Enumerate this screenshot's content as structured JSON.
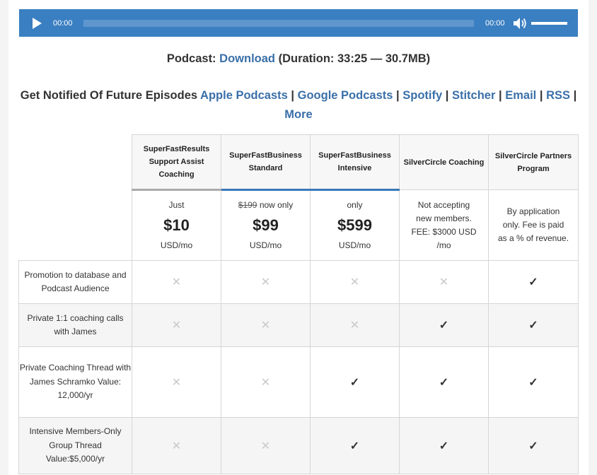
{
  "player": {
    "current_time": "00:00",
    "duration_time": "00:00",
    "colors": {
      "bar": "#3a7fc1",
      "rail": "#5f96cd"
    }
  },
  "podcast": {
    "prefix": "Podcast:",
    "download_label": "Download",
    "details": "(Duration: 33:25 — 30.7MB)"
  },
  "notify": {
    "label": "Get Notified Of Future Episodes",
    "links": [
      "Apple Podcasts",
      "Google Podcasts",
      "Spotify",
      "Stitcher",
      "Email",
      "RSS",
      "More"
    ],
    "separator": "|"
  },
  "plans": [
    {
      "name": "SuperFastResults Support Assist Coaching",
      "price_pre": "Just",
      "price": "$10",
      "price_post": "USD/mo"
    },
    {
      "name": "SuperFastBusiness Standard",
      "price_old": "$199",
      "price_pre": "now only",
      "price": "$99",
      "price_post": "USD/mo"
    },
    {
      "name": "SuperFastBusiness Intensive",
      "price_pre": "only",
      "price": "$599",
      "price_post": "USD/mo"
    },
    {
      "name": "SilverCircle Coaching",
      "price_text": "Not accepting new members. FEE: $3000 USD /mo"
    },
    {
      "name": "SilverCircle Partners Program",
      "price_text": "By application only. Fee is paid as a % of revenue."
    }
  ],
  "features": [
    {
      "label": "Promotion to database and Podcast Audience",
      "values": [
        false,
        false,
        false,
        false,
        true
      ]
    },
    {
      "label": "Private 1:1 coaching calls with James",
      "values": [
        false,
        false,
        false,
        true,
        true
      ]
    },
    {
      "label": "Private Coaching Thread with James Schramko Value: 12,000/yr",
      "values": [
        false,
        false,
        true,
        true,
        true
      ]
    },
    {
      "label": "Intensive Members-Only Group Thread Value:$5,000/yr",
      "values": [
        false,
        false,
        true,
        true,
        true
      ]
    }
  ],
  "symbols": {
    "cross": "✕",
    "check": "✓"
  },
  "colors": {
    "link": "#3a6fa8",
    "accent_bar": "#3a78b8"
  }
}
